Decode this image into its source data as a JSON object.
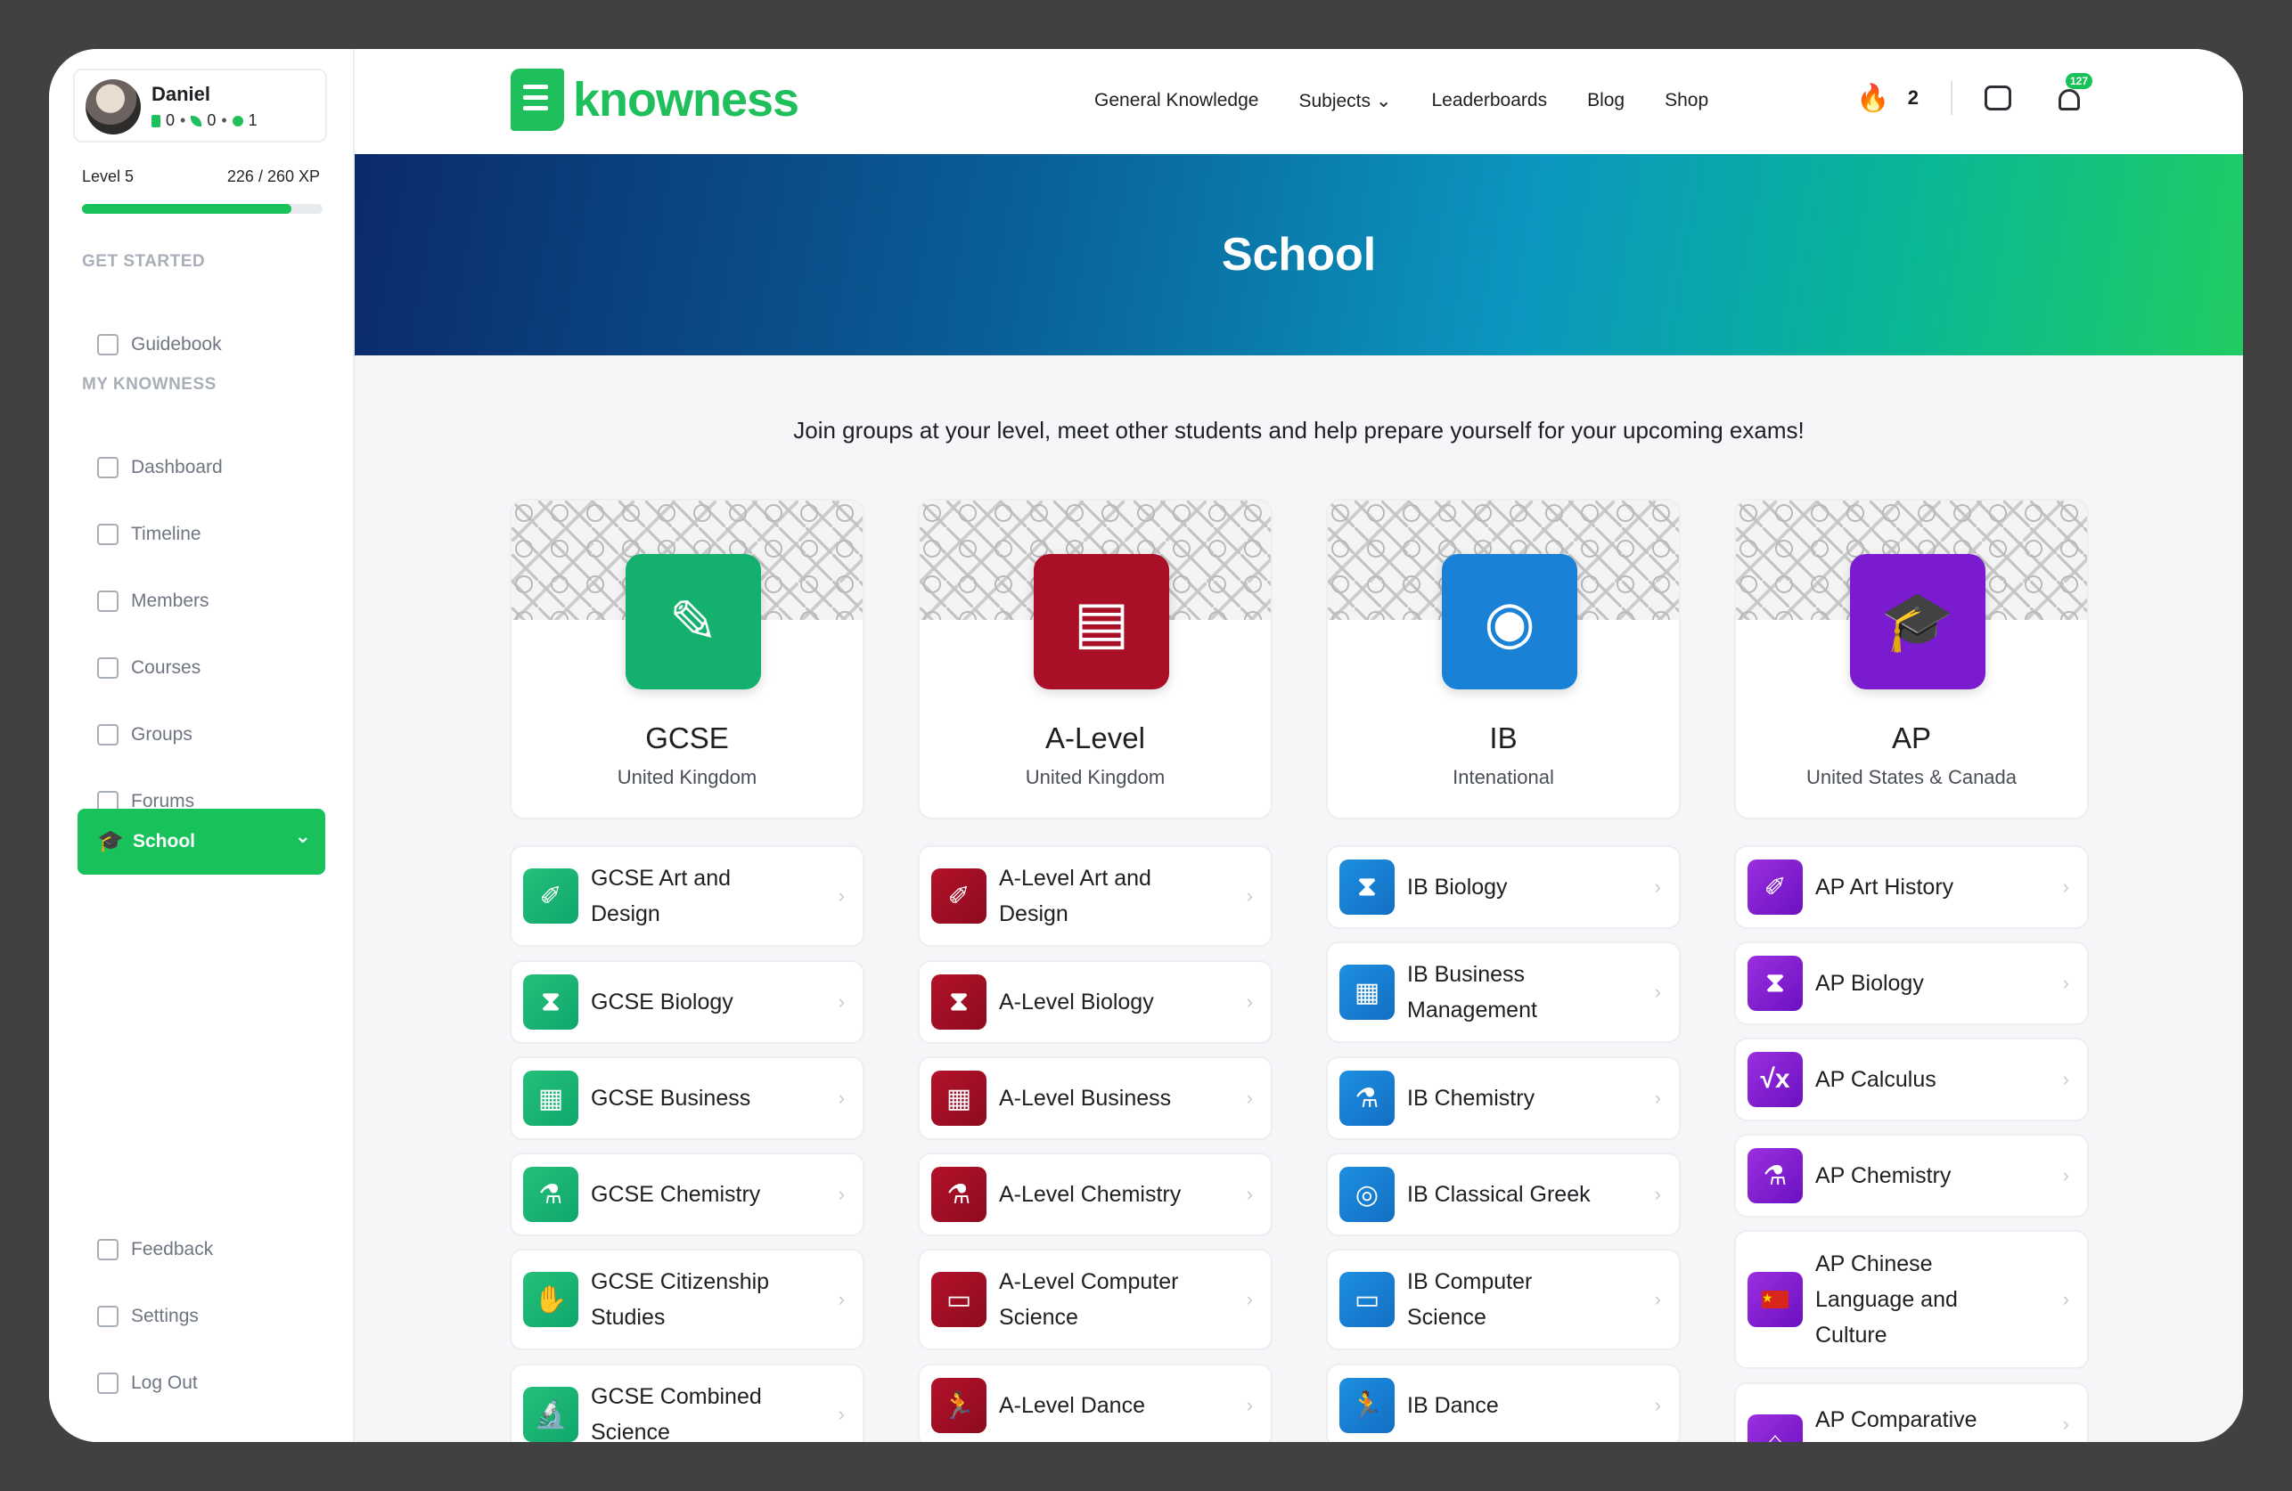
{
  "user": {
    "name": "Daniel",
    "stat_scrolls": "0",
    "stat_leaves": "0",
    "stat_dots": "1",
    "level": "Level 5",
    "xp": "226 / 260 XP",
    "xp_progress": 0.869
  },
  "sidebar": {
    "section_get_started": "GET STARTED",
    "guidebook": "Guidebook",
    "section_my": "MY KNOWNESS",
    "dashboard": "Dashboard",
    "timeline": "Timeline",
    "members": "Members",
    "courses": "Courses",
    "groups": "Groups",
    "forums": "Forums",
    "school": "School",
    "feedback": "Feedback",
    "settings": "Settings",
    "logout": "Log Out"
  },
  "header": {
    "logo": "knowness",
    "menu": [
      "General Knowledge",
      "Subjects",
      "Leaderboards",
      "Blog",
      "Shop"
    ],
    "streak": "2",
    "notifications": "127"
  },
  "banner": {
    "title": "School"
  },
  "intro": "Join groups at your level, meet other students and help prepare yourself for your upcoming exams!",
  "categories": [
    {
      "name": "GCSE",
      "region": "United Kingdom",
      "color": "#13b06e",
      "icon": "pencil-icon"
    },
    {
      "name": "A-Level",
      "region": "United Kingdom",
      "color": "#a90f26",
      "icon": "book-icon"
    },
    {
      "name": "IB",
      "region": "Intenational",
      "color": "#1a82d6",
      "icon": "globe-icon"
    },
    {
      "name": "AP",
      "region": "United States & Canada",
      "color": "#7a1bd0",
      "icon": "graduation-cap-icon"
    }
  ],
  "gcse": [
    "GCSE Art and Design",
    "GCSE Biology",
    "GCSE Business",
    "GCSE Chemistry",
    "GCSE Citizenship Studies",
    "GCSE Combined Science"
  ],
  "alevel": [
    "A-Level Art and Design",
    "A-Level Biology",
    "A-Level Business",
    "A-Level Chemistry",
    "A-Level Computer Science",
    "A-Level Dance"
  ],
  "ib": [
    "IB Biology",
    "IB Business Management",
    "IB Chemistry",
    "IB Classical Greek",
    "IB Computer Science",
    "IB Dance"
  ],
  "ap": [
    "AP Art History",
    "AP Biology",
    "AP Calculus",
    "AP Chemistry",
    "AP Chinese Language and Culture",
    "AP Comparative"
  ]
}
